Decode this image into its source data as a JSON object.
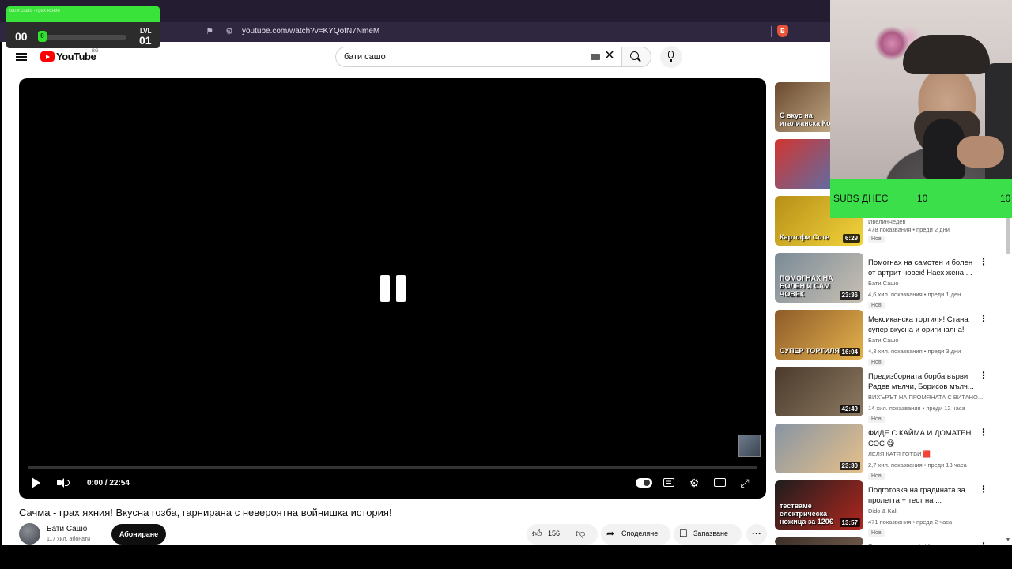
{
  "browser": {
    "url": "youtube.com/watch?v=KYQofN7NmeM"
  },
  "masthead": {
    "logo_text": "YouTube",
    "country_code": "BG",
    "search_value": "бати сашо"
  },
  "player": {
    "time_display": "0:00 / 22:54",
    "state": "paused",
    "progress": 0
  },
  "video": {
    "title": "Сачма - грах яхния! Вкусна гозба, гарнирана с невероятна войнишка история!",
    "channel_name": "Бати Сашо",
    "channel_subs": "117 хил. абонати",
    "subscribe_label": "Абониране",
    "likes": "156",
    "share_label": "Споделяне",
    "save_label": "Запазване"
  },
  "recommendations": [
    {
      "thumb_text": "С вкус на италианска Кол",
      "duration": "",
      "title": "",
      "channel": "",
      "meta": "",
      "badge": "",
      "colors": [
        "#6b4a2f",
        "#d7c19c"
      ]
    },
    {
      "thumb_text": "",
      "duration": "",
      "title": "",
      "channel": "",
      "meta": "",
      "badge": "",
      "colors": [
        "#d1352f",
        "#3f7cc4"
      ]
    },
    {
      "thumb_text": "Картофи Соте",
      "duration": "6:29",
      "title": "",
      "channel": "ИвелинЧедев",
      "meta": "478 показвания • преди 2 дни",
      "badge": "Нов",
      "colors": [
        "#b78f18",
        "#f2d43c"
      ]
    },
    {
      "thumb_text": "ПОМОГНАХ НА БОЛЕН И САМ ЧОВЕК",
      "duration": "23:36",
      "title": "Помогнах на самотен и болен от артрит човек! Наех жена ...",
      "channel": "Бати Сашо",
      "meta": "4,6 хил. показвания • преди 1 ден",
      "badge": "Нов",
      "colors": [
        "#7a8b96",
        "#c9c0b4"
      ]
    },
    {
      "thumb_text": "СУПЕР ТОРТИЛЯ",
      "duration": "16:04",
      "title": "Мексиканска тортиля! Стана супер вкусна и оригинална!",
      "channel": "Бати Сашо",
      "meta": "4,3 хил. показвания • преди 3 дни",
      "badge": "Нов",
      "colors": [
        "#8e5b2a",
        "#e4b24c"
      ]
    },
    {
      "thumb_text": "",
      "duration": "42:49",
      "title": "Предизборната борба върви. Радев мълчи, Борисов мълч...",
      "channel": "ВИХЪРЪТ НА ПРОМЯНАТА С ВИТАНО...",
      "meta": "14 хил. показвания • преди 12 часа",
      "badge": "Нов",
      "colors": [
        "#4b3a2c",
        "#8c7a62"
      ]
    },
    {
      "thumb_text": "",
      "duration": "23:30",
      "title": "ФИДЕ С КАЙМА И ДОМАТЕН СОС 😋",
      "channel": "ЛЕЛЯ КАТЯ ГОТВИ 🟥",
      "meta": "2,7 хил. показвания • преди 13 часа",
      "badge": "Нов",
      "colors": [
        "#8795a3",
        "#e8c08a"
      ]
    },
    {
      "thumb_text": "тестваме електрическа ножица за 120€",
      "duration": "13:57",
      "title": "Подготовка на градината за пролетта + тест на ...",
      "channel": "Dido & Kali",
      "meta": "471 показвания • преди 2 часа",
      "badge": "Нов",
      "colors": [
        "#1d1d1d",
        "#b2271f"
      ]
    },
    {
      "thumb_text": "",
      "duration": "",
      "title": "Ролята на граф Игнатиев в",
      "channel": "",
      "meta": "",
      "badge": "",
      "colors": [
        "#3b2f28",
        "#6b5648"
      ]
    }
  ],
  "overlay": {
    "bar_text": "бати сашо - грах яхния",
    "score": "00",
    "chip": "0",
    "lvl_label": "LVL",
    "lvl_num": "01",
    "progress": 0
  },
  "subs_widget": {
    "label": "SUBS ДНЕС",
    "current": "10",
    "goal": "10"
  },
  "colors": {
    "youtube_red": "#ff0000",
    "overlay_green": "#39e33a",
    "subs_green": "#3bdf49",
    "browser_chrome": "#2f2740"
  }
}
